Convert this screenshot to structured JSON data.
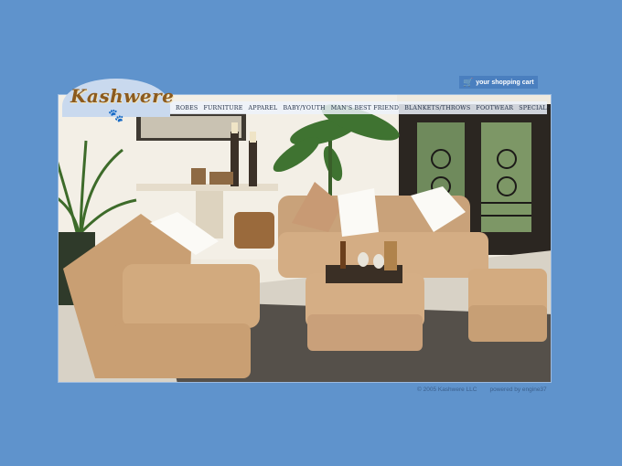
{
  "brand": {
    "logo_text": "Kashwere",
    "logo_icon": "paw-print-icon"
  },
  "cart": {
    "label": "your shopping cart",
    "icon": "shopping-cart-icon"
  },
  "nav": {
    "items": [
      {
        "label": "ROBES"
      },
      {
        "label": "FURNITURE"
      },
      {
        "label": "APPAREL"
      },
      {
        "label": "BABY/YOUTH"
      },
      {
        "label": "MAN'S BEST FRIEND"
      },
      {
        "label": "BLANKETS/THROWS"
      },
      {
        "label": "FOOTWEAR"
      },
      {
        "label": "SPECIALS"
      }
    ]
  },
  "footer": {
    "copyright": "© 2005 Kashwere LLC",
    "powered": "powered by engine37"
  },
  "colors": {
    "background": "#5f93cc",
    "cart_button": "#4a7fbf",
    "nav_bar": "#ecf2fa",
    "logo_brown": "#8b5a1e"
  }
}
